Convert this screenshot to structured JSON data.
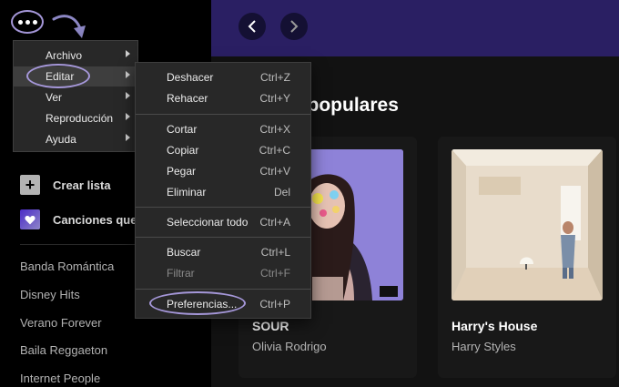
{
  "sidebar": {
    "create_playlist": "Crear lista",
    "liked_songs": "Canciones que",
    "playlists": [
      "Banda Romántica",
      "Disney Hits",
      "Verano Forever",
      "Baila Reggaeton",
      "Internet People"
    ]
  },
  "main": {
    "section_title": "s populares",
    "albums": [
      {
        "title": "SOUR",
        "artist": "Olivia Rodrigo"
      },
      {
        "title": "Harry's House",
        "artist": "Harry Styles"
      }
    ]
  },
  "menu": {
    "items": [
      {
        "label": "Archivo"
      },
      {
        "label": "Editar"
      },
      {
        "label": "Ver"
      },
      {
        "label": "Reproducción"
      },
      {
        "label": "Ayuda"
      }
    ]
  },
  "submenu": {
    "items": [
      {
        "label": "Deshacer",
        "shortcut": "Ctrl+Z"
      },
      {
        "label": "Rehacer",
        "shortcut": "Ctrl+Y"
      },
      {
        "label": "Cortar",
        "shortcut": "Ctrl+X"
      },
      {
        "label": "Copiar",
        "shortcut": "Ctrl+C"
      },
      {
        "label": "Pegar",
        "shortcut": "Ctrl+V"
      },
      {
        "label": "Eliminar",
        "shortcut": "Del"
      },
      {
        "label": "Seleccionar todo",
        "shortcut": "Ctrl+A"
      },
      {
        "label": "Buscar",
        "shortcut": "Ctrl+L"
      },
      {
        "label": "Filtrar",
        "shortcut": "Ctrl+F"
      },
      {
        "label": "Preferencias...",
        "shortcut": "Ctrl+P"
      }
    ]
  },
  "colors": {
    "annotation": "#a597d9",
    "topbar": "#2a1f63",
    "menu_bg": "#282828"
  }
}
